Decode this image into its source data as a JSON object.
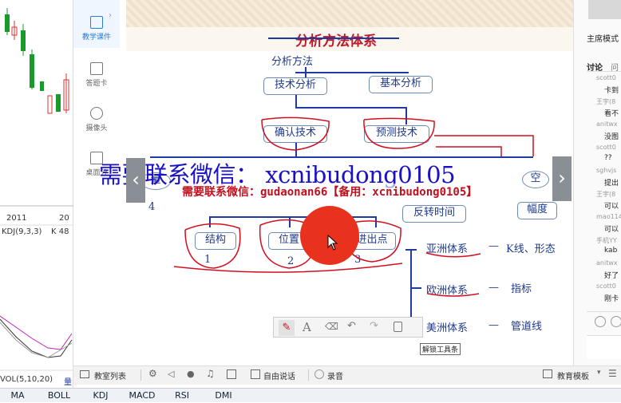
{
  "chart": {
    "year_a": "2011",
    "year_b": "20",
    "kdj_label": "KDJ(9,3,3)",
    "k_value": "K 48",
    "vol_label": "VOL(5,10,20)",
    "vol_char": "量"
  },
  "tools": {
    "courseware": "教学课件",
    "answer_card": "答题卡",
    "camera": "摄像头",
    "desktop": "桌面分"
  },
  "slide": {
    "title": "分析方法体系",
    "root": "分析方法",
    "tech": "技术分析",
    "basic": "基本分析",
    "confirm": "确认技术",
    "predict": "预测技术",
    "left_partial": "量",
    "right_partial": "空",
    "num4": "4",
    "structure": "结构",
    "position": "位置",
    "entry": "进出点",
    "n1": "1",
    "n2": "2",
    "n3": "3",
    "reversal": "反转时间",
    "amplitude": "幅度",
    "asia": "亚洲体系",
    "asia_val": "K线、形态",
    "europe": "欧洲体系",
    "europe_val": "指标",
    "america": "美洲体系",
    "america_val": "管道线",
    "dash": "—"
  },
  "watermark": {
    "large": "需要联系微信： xcnibudong0105",
    "banner": "需要联系微信：gudaonan66【备用：xcnibudong0105】"
  },
  "annot_tools": {
    "tooltip": "解锁工具条"
  },
  "sidebar": {
    "host_mode": "主席模式",
    "tab1": "讨论",
    "tab2": "问",
    "comments": [
      {
        "user": "scott0",
        "text": "卡到"
      },
      {
        "user": "王宇(8",
        "text": "看不"
      },
      {
        "user": "anitwx",
        "text": "没图"
      },
      {
        "user": "scott0",
        "text": "??"
      },
      {
        "user": "sghvjs",
        "text": "提出"
      },
      {
        "user": "王宇(8",
        "text": "可以"
      },
      {
        "user": "mao114",
        "text": "可以"
      },
      {
        "user": "手机YY",
        "text": "kab"
      },
      {
        "user": "anitwx",
        "text": "好了"
      },
      {
        "user": "scott0",
        "text": "刚卡"
      }
    ]
  },
  "bottombar": {
    "class_list": "教室列表",
    "free_talk": "自由说话",
    "record": "录音",
    "classroom_template": "教育模板"
  },
  "indicators": [
    "MA",
    "BOLL",
    "KDJ",
    "MACD",
    "RSI",
    "DMI"
  ],
  "colors": {
    "accent_red": "#e8321e",
    "slide_blue": "#1f3a8a",
    "annot_red": "#d01020",
    "panel_blue": "#f0f6ff"
  }
}
